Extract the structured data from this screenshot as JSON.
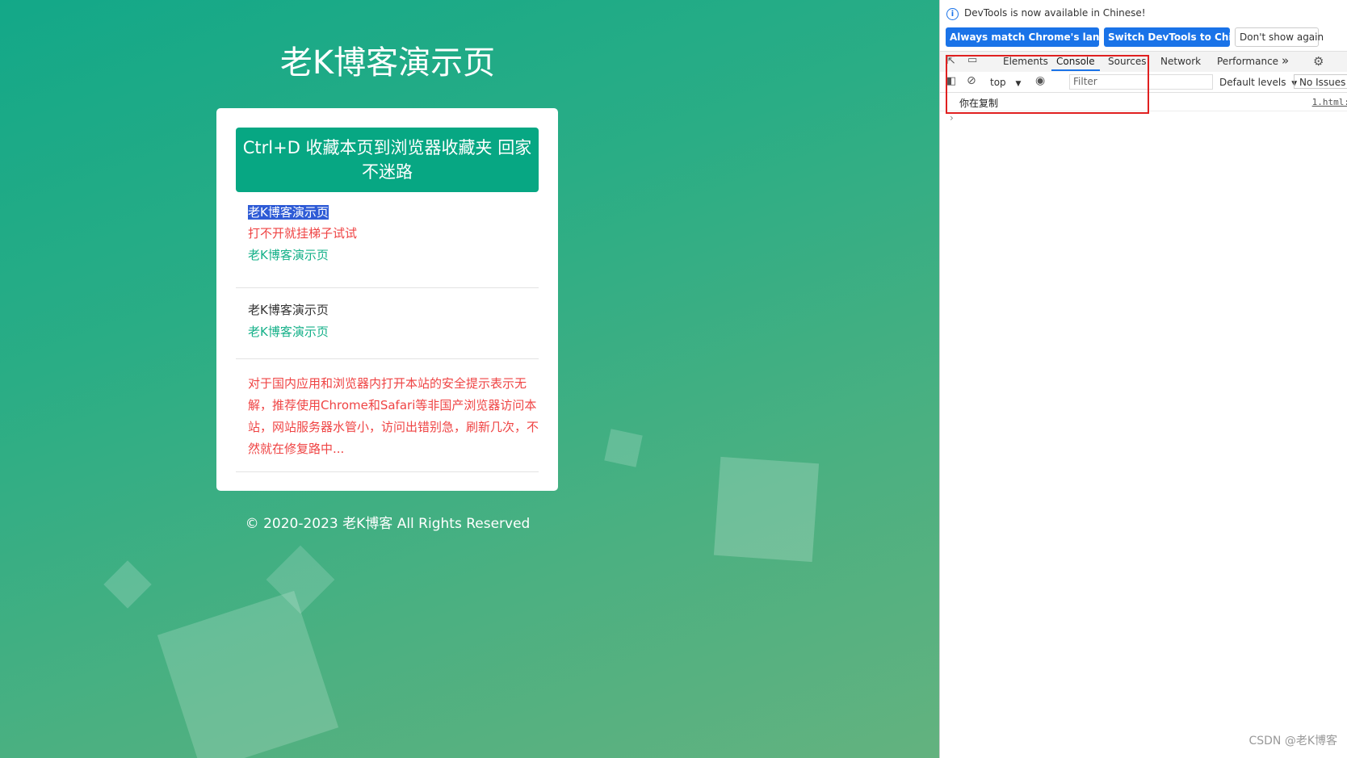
{
  "page": {
    "title": "老K博客演示页",
    "banner": "Ctrl+D 收藏本页到浏览器收藏夹 回家不迷路",
    "links": [
      {
        "text": "老K博客演示页",
        "style": "selected"
      },
      {
        "text": "打不开就挂梯子试试",
        "style": "red"
      },
      {
        "text": "老K博客演示页",
        "style": "green"
      }
    ],
    "links2": [
      {
        "text": "老K博客演示页",
        "style": "dark"
      },
      {
        "text": "老K博客演示页",
        "style": "green"
      }
    ],
    "notice": "对于国内应用和浏览器内打开本站的安全提示表示无解，推荐使用Chrome和Safari等非国产浏览器访问本站，网站服务器水管小，访问出错别急，刷新几次，不然就在修复路中...",
    "footer": "© 2020-2023 老K博客 All Rights Reserved",
    "colors": {
      "banner": "#07a783",
      "accent_red": "#ef4444",
      "accent_green": "#14b088",
      "selection": "#2e5bd6"
    }
  },
  "devtools": {
    "info_text": "DevTools is now available in Chinese!",
    "btn_match": "Always match Chrome's language",
    "btn_switch": "Switch DevTools to Chinese",
    "btn_dismiss": "Don't show again",
    "tabs": [
      "Elements",
      "Console",
      "Sources",
      "Network",
      "Performance"
    ],
    "active_tab": "Console",
    "more_tabs": "»",
    "context": "top",
    "filter_placeholder": "Filter",
    "levels": "Default levels",
    "issues": "No Issues",
    "console_message": "你在复制",
    "console_source": "1.html:",
    "prompt": "›",
    "accent": "#1a73e8"
  },
  "watermark": "CSDN @老K博客"
}
